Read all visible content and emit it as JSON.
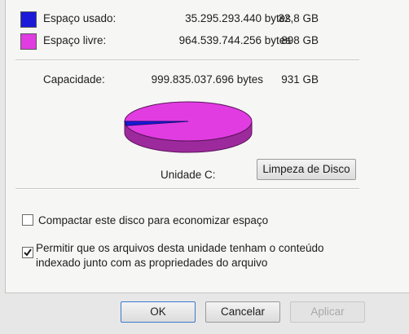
{
  "usage": {
    "used": {
      "label": "Espaço usado:",
      "bytes": "35.295.293.440 bytes",
      "size": "32,8 GB",
      "color": "#1a1ad8"
    },
    "free": {
      "label": "Espaço livre:",
      "bytes": "964.539.744.256 bytes",
      "size": "898 GB",
      "color": "#e13ce1"
    },
    "capacity": {
      "label": "Capacidade:",
      "bytes": "999.835.037.696 bytes",
      "size": "931 GB"
    }
  },
  "pie": {
    "used_fraction": 0.035
  },
  "drive": {
    "label": "Unidade C:",
    "cleanup_button": "Limpeza de Disco"
  },
  "options": {
    "compress": {
      "label": "Compactar este disco para economizar espaço",
      "checked": false
    },
    "index": {
      "label_line1": "Permitir que os arquivos desta unidade tenham o conteúdo",
      "label_line2": "indexado junto com as propriedades do arquivo",
      "checked": true
    }
  },
  "buttons": {
    "ok": "OK",
    "cancel": "Cancelar",
    "apply": "Aplicar"
  }
}
